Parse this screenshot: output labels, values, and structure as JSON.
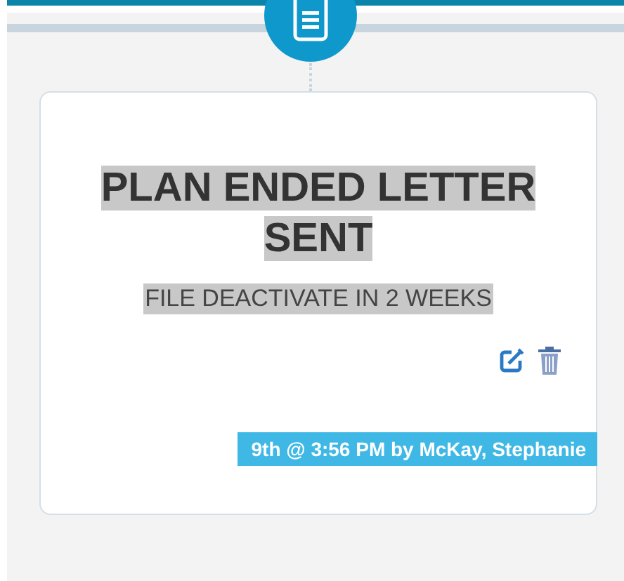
{
  "event": {
    "title": "PLAN ENDED LETTER SENT",
    "subtitle": "FILE DEACTIVATE IN 2 WEEKS",
    "timestamp": "9th @ 3:56 PM by McKay, Stephanie"
  }
}
